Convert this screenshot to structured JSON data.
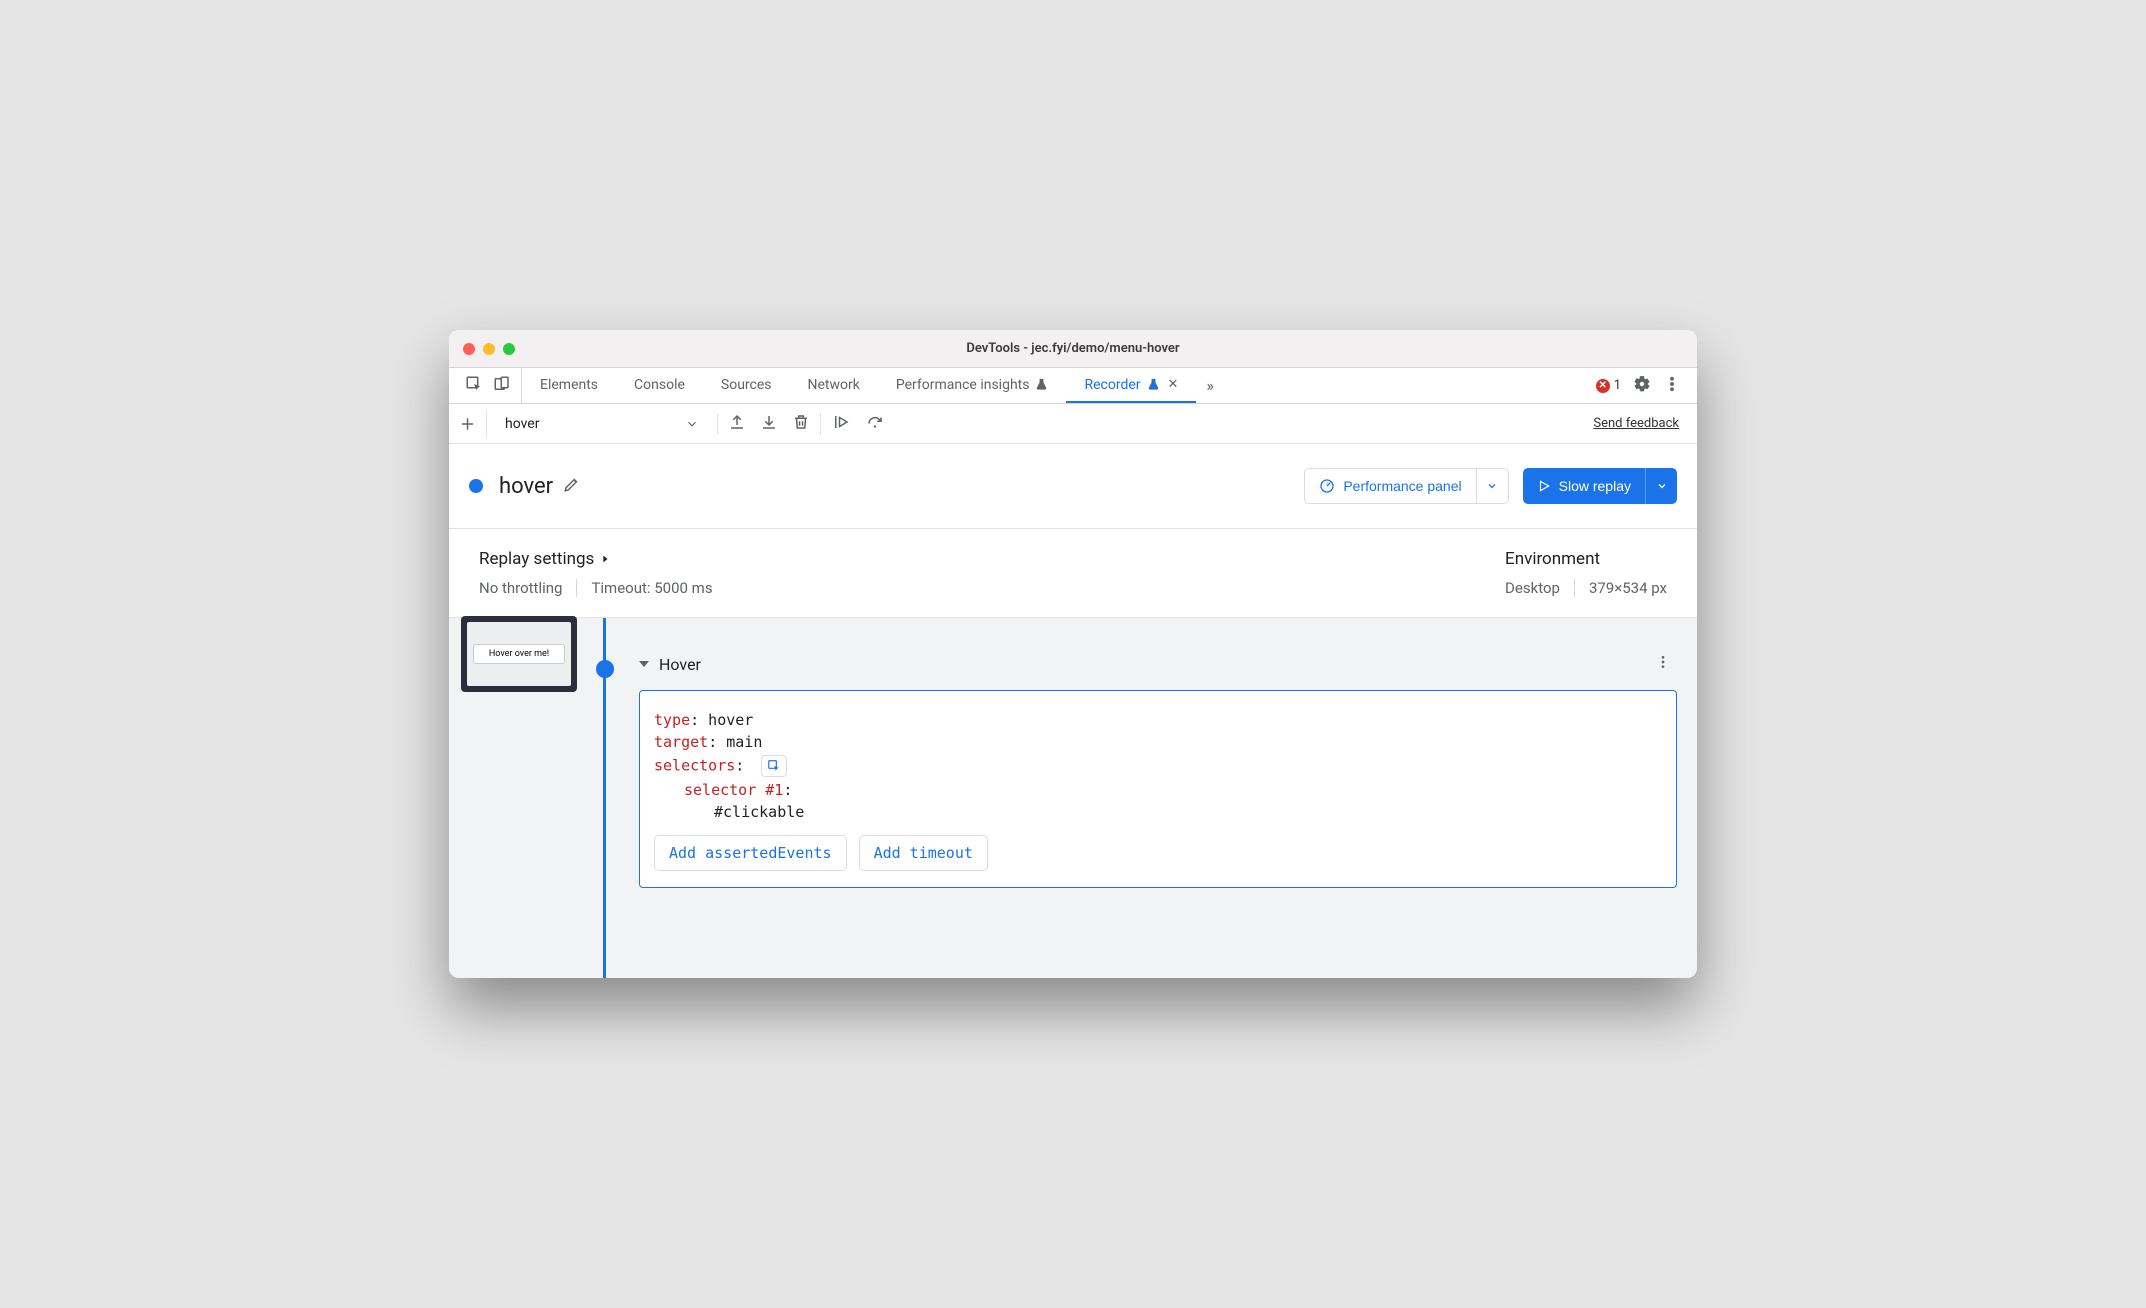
{
  "window": {
    "title": "DevTools - jec.fyi/demo/menu-hover"
  },
  "tabs": {
    "elements": "Elements",
    "console": "Console",
    "sources": "Sources",
    "network": "Network",
    "performance_insights": "Performance insights",
    "recorder": "Recorder"
  },
  "error_count": "1",
  "toolbar": {
    "recording_name": "hover",
    "feedback": "Send feedback"
  },
  "header": {
    "recording_title": "hover",
    "performance_panel": "Performance panel",
    "slow_replay": "Slow replay"
  },
  "settings": {
    "replay_heading": "Replay settings",
    "throttling": "No throttling",
    "timeout": "Timeout: 5000 ms",
    "env_heading": "Environment",
    "env_device": "Desktop",
    "env_size": "379×534 px"
  },
  "thumb": {
    "button_label": "Hover over me!"
  },
  "step": {
    "name": "Hover",
    "kv": {
      "type_key": "type",
      "type_val": ": hover",
      "target_key": "target",
      "target_val": ": main",
      "selectors_key": "selectors",
      "selectors_colon": ":",
      "selector1_key": "selector #1",
      "selector1_colon": ":",
      "selector1_val": "#clickable"
    },
    "add_asserted": "Add assertedEvents",
    "add_timeout": "Add timeout"
  }
}
